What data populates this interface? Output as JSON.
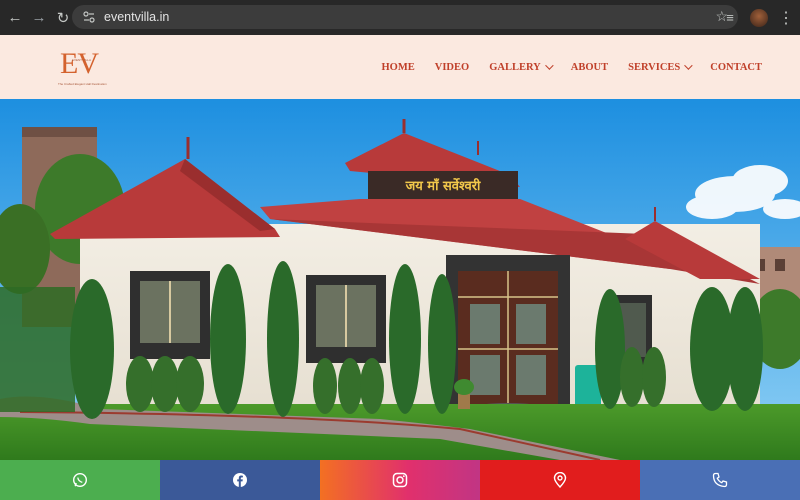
{
  "browser": {
    "url": "eventvilla.in",
    "icons": [
      "back-arrow-icon",
      "forward-arrow-icon",
      "reload-icon",
      "site-info-icon",
      "bookmark-star-icon",
      "reading-list-icon",
      "profile-avatar",
      "menu-dots-icon"
    ]
  },
  "logo": {
    "text": "EV",
    "subtitle": "EVENT VILLA",
    "tagline": "The Crafted Elegant Hall Destination"
  },
  "nav": [
    {
      "label": "HOME",
      "dropdown": false
    },
    {
      "label": "VIDEO",
      "dropdown": false
    },
    {
      "label": "GALLERY",
      "dropdown": true
    },
    {
      "label": "ABOUT",
      "dropdown": false
    },
    {
      "label": "SERVICES",
      "dropdown": true
    },
    {
      "label": "CONTACT",
      "dropdown": false
    }
  ],
  "hero": {
    "building_sign": "जय माँ सर्वेश्वरी"
  },
  "contact_bar": [
    {
      "icon": "whatsapp-icon",
      "color": "#4cae4f"
    },
    {
      "icon": "facebook-icon",
      "color": "#3b5998"
    },
    {
      "icon": "instagram-icon",
      "color": "#e1306c"
    },
    {
      "icon": "map-pin-icon",
      "color": "#e11d1d"
    },
    {
      "icon": "phone-icon",
      "color": "#4a6fb5"
    }
  ],
  "colors": {
    "header_bg": "#fbe9e0",
    "brand": "#c0402a",
    "roof": "#b83a3a"
  }
}
